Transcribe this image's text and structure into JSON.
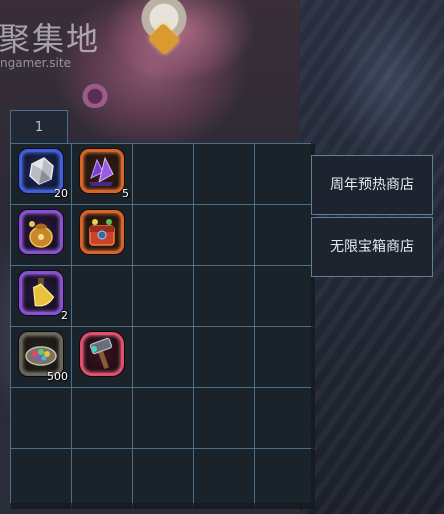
{
  "watermark": {
    "text": "聚集地",
    "url": "ngamer.site"
  },
  "inventory": {
    "tab_label": "1",
    "columns": 5,
    "rows": 6,
    "items": [
      {
        "slot": 0,
        "icon": "silver-ore-icon",
        "rarity": "blue",
        "count": "20"
      },
      {
        "slot": 1,
        "icon": "purple-crystal-icon",
        "rarity": "orange",
        "count": "5"
      },
      {
        "slot": 5,
        "icon": "gold-pouch-icon",
        "rarity": "purple",
        "count": ""
      },
      {
        "slot": 6,
        "icon": "red-chest-icon",
        "rarity": "orange",
        "count": ""
      },
      {
        "slot": 10,
        "icon": "yellow-potion-icon",
        "rarity": "purple",
        "count": "2"
      },
      {
        "slot": 15,
        "icon": "gem-bowl-icon",
        "rarity": "gray",
        "count": "500"
      },
      {
        "slot": 16,
        "icon": "hammer-icon",
        "rarity": "red",
        "count": ""
      }
    ]
  },
  "shops": {
    "anniversary_label": "周年预热商店",
    "infinite_chest_label": "无限宝箱商店"
  },
  "colors": {
    "grid_border": "#4a6f8a",
    "rarity_blue": "#3f5fe0",
    "rarity_orange": "#d9642a",
    "rarity_purple": "#8a4fd6",
    "rarity_gray": "#6b665c",
    "rarity_red": "#e0506e"
  }
}
